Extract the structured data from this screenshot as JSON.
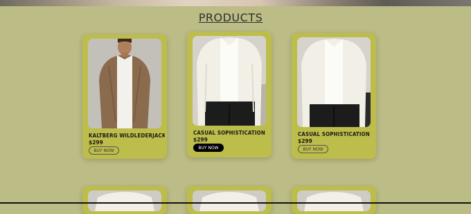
{
  "page": {
    "section_title": "PRODUCTS"
  },
  "products": [
    {
      "name": "KALTBERG WILDLEDERJACKET",
      "price": "$299",
      "button": "BUY NOW",
      "style": "outline",
      "image": "brown-suede-jacket"
    },
    {
      "name": "CASUAL SOPHISTICATION",
      "price": "$299",
      "button": "BUY NOW",
      "style": "filled",
      "image": "cream-overshirt"
    },
    {
      "name": "CASUAL SOPHISTICATION",
      "price": "$299",
      "button": "BUY NOW",
      "style": "outline",
      "image": "cream-overshirt"
    }
  ],
  "colors": {
    "background": "#bcbc86",
    "card": "#bdbd4b",
    "button_filled": "#000000"
  }
}
